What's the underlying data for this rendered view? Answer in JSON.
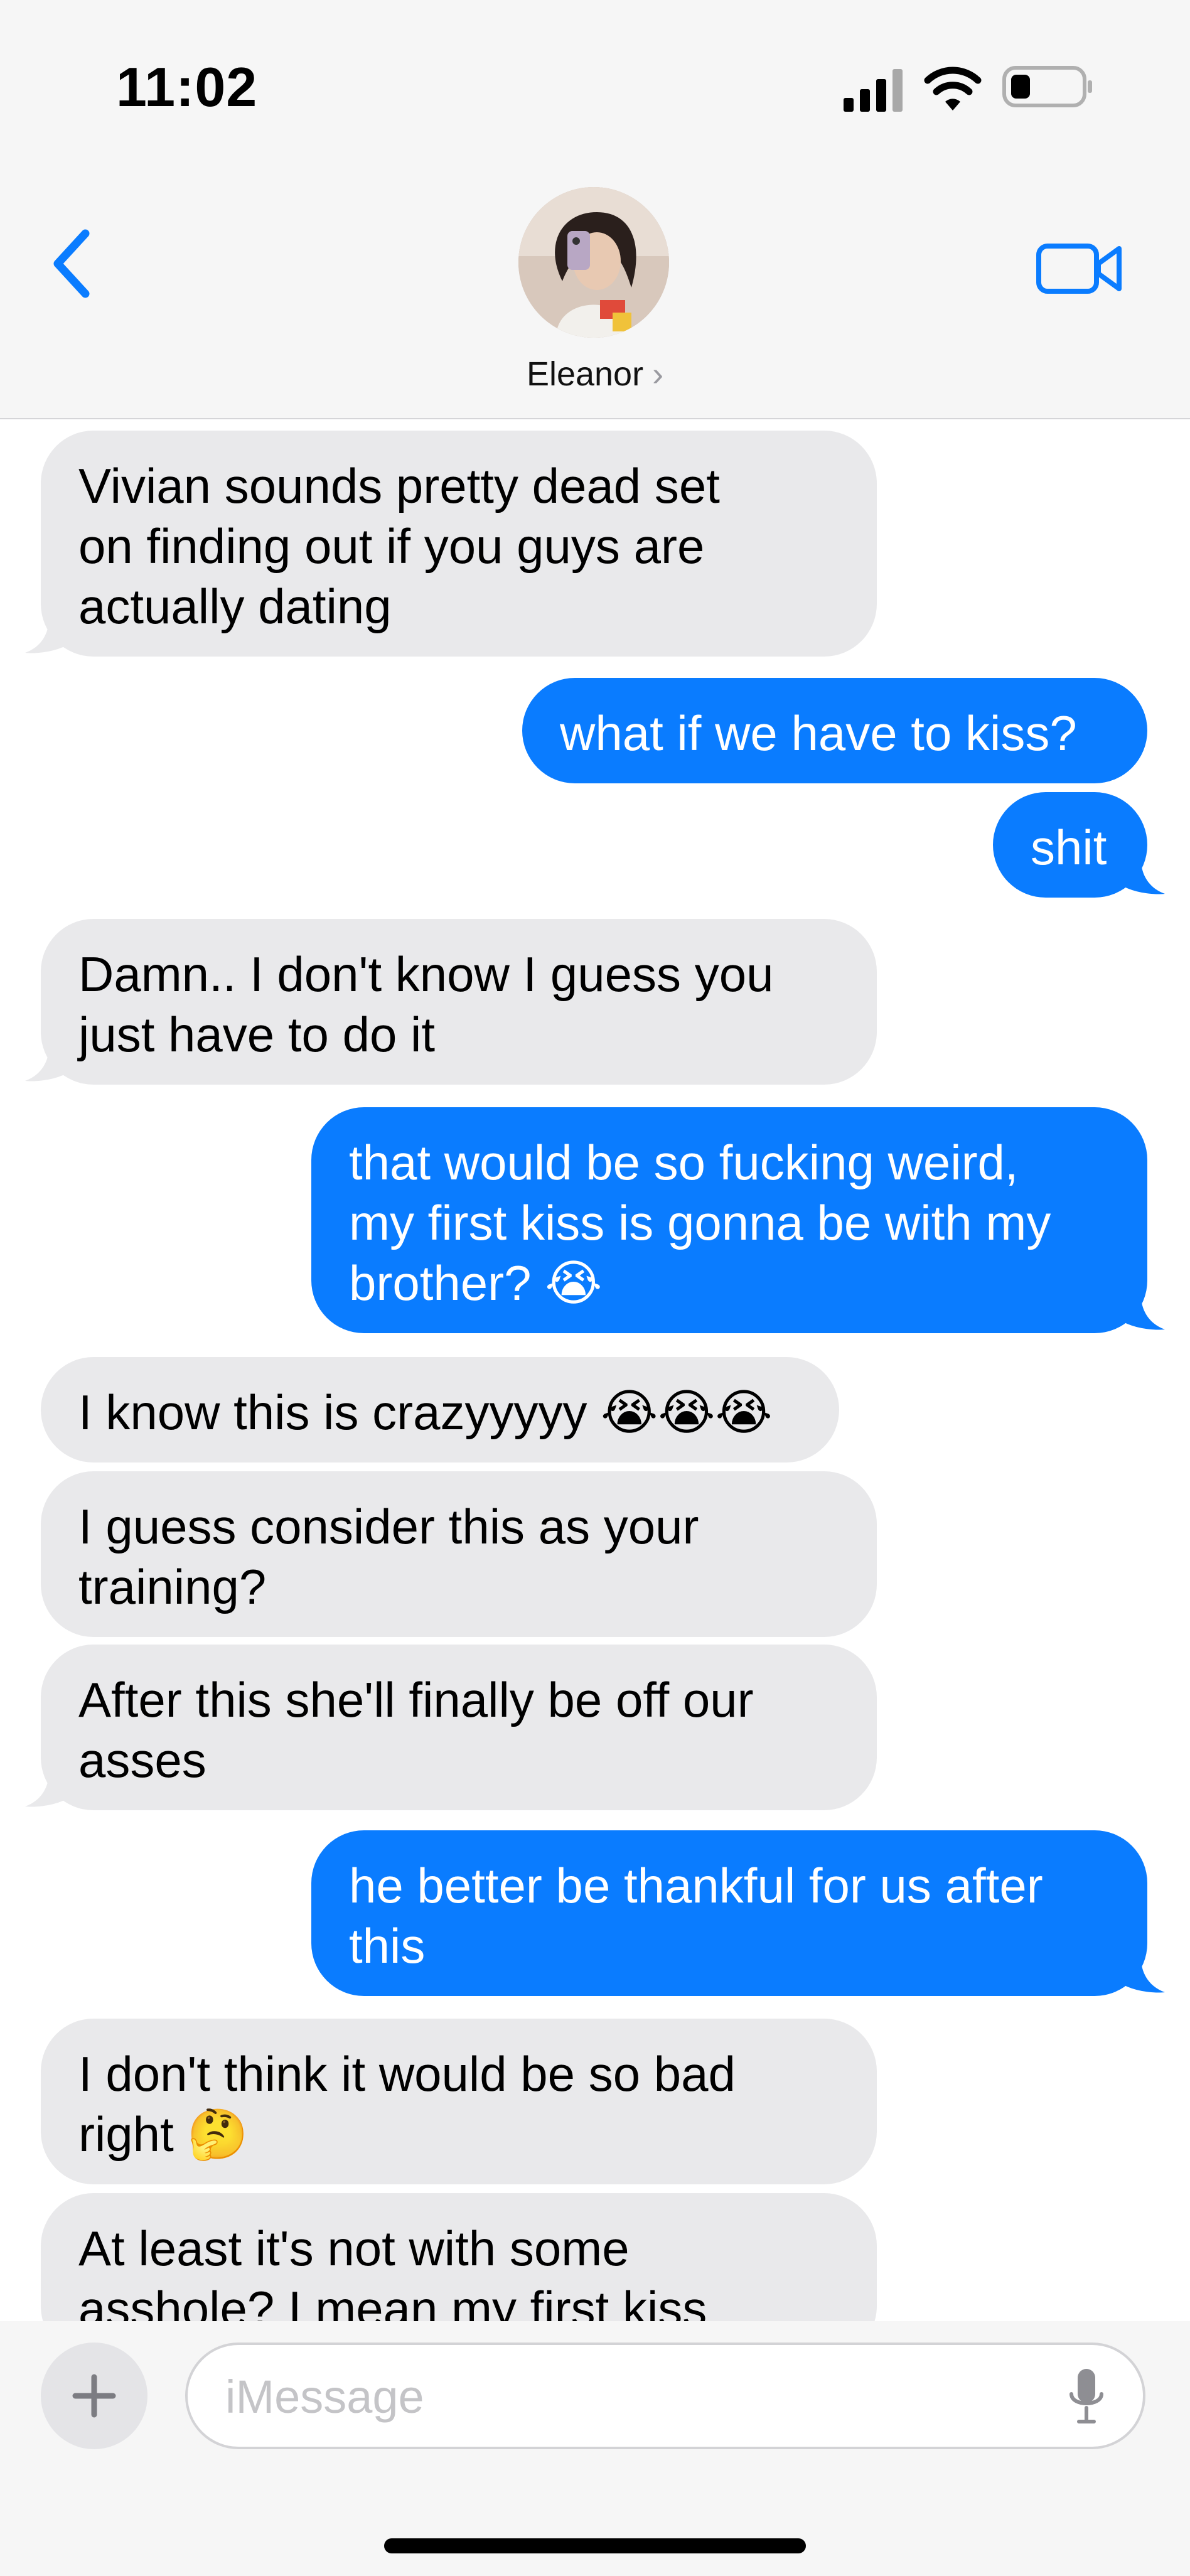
{
  "status_bar": {
    "time": "11:02"
  },
  "header": {
    "contact_name": "Eleanor",
    "chevron": "›"
  },
  "messages": [
    {
      "side": "received",
      "text": "Vivian sounds pretty dead set\non finding out if you guys are\nactually dating"
    },
    {
      "side": "sent",
      "text": "what if we have to kiss?"
    },
    {
      "side": "sent",
      "text": "shit"
    },
    {
      "side": "received",
      "text": "Damn.. I don't know I guess you\njust have to do it"
    },
    {
      "side": "sent",
      "text": "that would be so fucking weird,\nmy first kiss is gonna be with my\nbrother? 😭"
    },
    {
      "side": "received",
      "text": "I know this is crazyyyyy 😭😭😭"
    },
    {
      "side": "received",
      "text": "I guess consider this as your\ntraining?"
    },
    {
      "side": "received",
      "text": "After this she'll finally be off our\nasses"
    },
    {
      "side": "sent",
      "text": "he better be thankful for us after\nthis"
    },
    {
      "side": "received",
      "text": "I don't think it would be so bad\nright 🤔"
    },
    {
      "side": "received",
      "text": "At least it's not with some\nasshole? I mean my first kiss"
    }
  ],
  "input": {
    "placeholder": "iMessage",
    "plus_label": "+"
  },
  "icons": {
    "back": "chevron-left-icon",
    "video": "video-camera-icon",
    "mic": "microphone-icon",
    "signal": "cellular-signal-icon",
    "wifi": "wifi-icon",
    "battery": "battery-icon"
  },
  "colors": {
    "sent_bubble": "#0a7cff",
    "received_bubble": "#e9e9eb",
    "accent": "#0a7cff"
  }
}
